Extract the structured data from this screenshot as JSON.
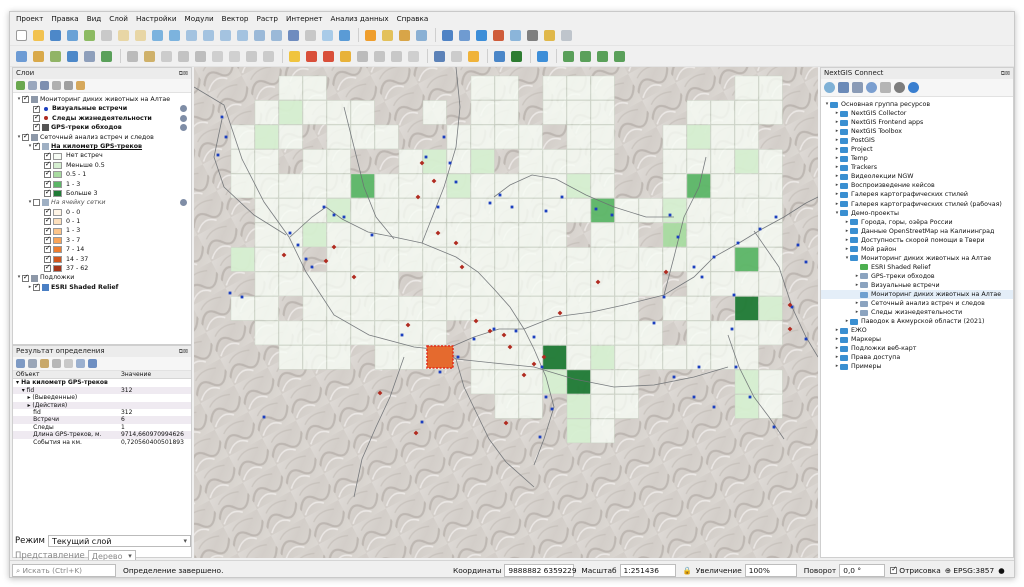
{
  "menu": [
    "Проект",
    "Правка",
    "Вид",
    "Слой",
    "Настройки",
    "Модули",
    "Вектор",
    "Растр",
    "Интернет",
    "Анализ данных",
    "Справка"
  ],
  "layers_panel": {
    "title": "Слои",
    "items": [
      {
        "label": "Мониторинг диких животных на Алтае",
        "level": 0,
        "twisty": "▾",
        "checked": true,
        "icon": "group",
        "style": ""
      },
      {
        "label": "Визуальные встречи",
        "level": 1,
        "twisty": "",
        "checked": true,
        "icon": "point-blue",
        "style": "bold",
        "flag": true
      },
      {
        "label": "Следы жизнедеятельности",
        "level": 1,
        "twisty": "",
        "checked": true,
        "icon": "point-red",
        "style": "bold",
        "flag": true
      },
      {
        "label": "GPS-треки обходов",
        "level": 1,
        "twisty": "",
        "checked": true,
        "icon": "line",
        "style": "bold",
        "flag": true
      },
      {
        "label": "Сеточный анализ встреч и следов",
        "level": 0,
        "twisty": "▾",
        "checked": true,
        "icon": "group",
        "style": ""
      },
      {
        "label": "На километр GPS-треков",
        "level": 1,
        "twisty": "▾",
        "checked": true,
        "icon": "poly",
        "style": "bold ul"
      },
      {
        "label": "Нет встреч",
        "level": 2,
        "twisty": "",
        "checked": true,
        "swatch": "#f6fbf4",
        "style": ""
      },
      {
        "label": "Меньше 0.5",
        "level": 2,
        "twisty": "",
        "checked": true,
        "swatch": "#d6efd1",
        "style": ""
      },
      {
        "label": "0.5 - 1",
        "level": 2,
        "twisty": "",
        "checked": true,
        "swatch": "#a8dba0",
        "style": ""
      },
      {
        "label": "1 - 3",
        "level": 2,
        "twisty": "",
        "checked": true,
        "swatch": "#5cb667",
        "style": ""
      },
      {
        "label": "Больше 3",
        "level": 2,
        "twisty": "",
        "checked": true,
        "swatch": "#1f7a35",
        "style": ""
      },
      {
        "label": "На ячейку сетки",
        "level": 1,
        "twisty": "▾",
        "checked": false,
        "icon": "poly",
        "style": "ital",
        "flag": true
      },
      {
        "label": "0 - 0",
        "level": 2,
        "twisty": "",
        "checked": true,
        "swatch": "#fff5e6",
        "style": ""
      },
      {
        "label": "0 - 1",
        "level": 2,
        "twisty": "",
        "checked": true,
        "swatch": "#fde0bd",
        "style": ""
      },
      {
        "label": "1 - 3",
        "level": 2,
        "twisty": "",
        "checked": true,
        "swatch": "#fcc58a",
        "style": ""
      },
      {
        "label": "3 - 7",
        "level": 2,
        "twisty": "",
        "checked": true,
        "swatch": "#f9a458",
        "style": ""
      },
      {
        "label": "7 - 14",
        "level": 2,
        "twisty": "",
        "checked": true,
        "swatch": "#ee7d2f",
        "style": ""
      },
      {
        "label": "14 - 37",
        "level": 2,
        "twisty": "",
        "checked": true,
        "swatch": "#d2561c",
        "style": ""
      },
      {
        "label": "37 - 62",
        "level": 2,
        "twisty": "",
        "checked": true,
        "swatch": "#a6361a",
        "style": ""
      },
      {
        "label": "Подложки",
        "level": 0,
        "twisty": "▾",
        "checked": true,
        "icon": "group",
        "style": ""
      },
      {
        "label": "ESRI Shaded Relief",
        "level": 1,
        "twisty": "▸",
        "checked": true,
        "icon": "raster",
        "style": "bold"
      }
    ]
  },
  "identify_panel": {
    "title": "Результат определения",
    "col_feature": "Объект",
    "col_value": "Значение",
    "rows": [
      {
        "k": "▾ На километр GPS-треков",
        "v": "",
        "bold": true
      },
      {
        "k": "   ▾ fid",
        "v": "312",
        "bold": false
      },
      {
        "k": "      ▸ (Выведенные)",
        "v": "",
        "bold": false
      },
      {
        "k": "      ▸ (Действия)",
        "v": "",
        "bold": false
      },
      {
        "k": "         fid",
        "v": "312",
        "bold": false
      },
      {
        "k": "         Встречи",
        "v": "6",
        "bold": false
      },
      {
        "k": "         Следы",
        "v": "1",
        "bold": false
      },
      {
        "k": "         Длина GPS-треков, м.",
        "v": "9714,660970994626",
        "bold": false
      },
      {
        "k": "         События на км.",
        "v": "0,720560400501893",
        "bold": false
      }
    ],
    "mode_label": "Режим",
    "mode_value": "Текущий слой",
    "view_label": "Представление",
    "view_value": "Дерево"
  },
  "connect_panel": {
    "title": "NextGIS Connect",
    "items": [
      {
        "label": "Основная группа ресурсов",
        "level": 0,
        "twisty": "▾",
        "icon": "folder"
      },
      {
        "label": "NextGIS Collector",
        "level": 1,
        "twisty": "▸",
        "icon": "folder"
      },
      {
        "label": "NextGIS Frontend apps",
        "level": 1,
        "twisty": "▸",
        "icon": "folder"
      },
      {
        "label": "NextGIS Toolbox",
        "level": 1,
        "twisty": "▸",
        "icon": "folder"
      },
      {
        "label": "PostGIS",
        "level": 1,
        "twisty": "▸",
        "icon": "folder"
      },
      {
        "label": "Project",
        "level": 1,
        "twisty": "▸",
        "icon": "folder"
      },
      {
        "label": "Temp",
        "level": 1,
        "twisty": "▸",
        "icon": "folder"
      },
      {
        "label": "Trackers",
        "level": 1,
        "twisty": "▸",
        "icon": "folder"
      },
      {
        "label": "Видеолекции NGW",
        "level": 1,
        "twisty": "▸",
        "icon": "folder"
      },
      {
        "label": "Воспроизведение кейсов",
        "level": 1,
        "twisty": "▸",
        "icon": "folder"
      },
      {
        "label": "Галерея картографических стилей",
        "level": 1,
        "twisty": "▸",
        "icon": "folder"
      },
      {
        "label": "Галерея картографических стилей (рабочая)",
        "level": 1,
        "twisty": "▸",
        "icon": "folder"
      },
      {
        "label": "Демо-проекты",
        "level": 1,
        "twisty": "▾",
        "icon": "folder"
      },
      {
        "label": "Города, горы, озёра России",
        "level": 2,
        "twisty": "▸",
        "icon": "folder"
      },
      {
        "label": "Данные OpenStreetMap на Калининград",
        "level": 2,
        "twisty": "▸",
        "icon": "folder"
      },
      {
        "label": "Доступность скорой помощи в Твери",
        "level": 2,
        "twisty": "▸",
        "icon": "folder"
      },
      {
        "label": "Мой район",
        "level": 2,
        "twisty": "▸",
        "icon": "folder"
      },
      {
        "label": "Мониторинг диких животных на Алтае",
        "level": 2,
        "twisty": "▾",
        "icon": "folder"
      },
      {
        "label": "ESRI Shaded Relief",
        "level": 3,
        "twisty": "",
        "icon": "raster"
      },
      {
        "label": "GPS-треки обходов",
        "level": 3,
        "twisty": "▸",
        "icon": "vector"
      },
      {
        "label": "Визуальные встречи",
        "level": 3,
        "twisty": "▸",
        "icon": "vector"
      },
      {
        "label": "Мониторинг диких животных на Алтае",
        "level": 3,
        "twisty": "",
        "icon": "webmap",
        "selected": true
      },
      {
        "label": "Сеточный анализ встреч и следов",
        "level": 3,
        "twisty": "▸",
        "icon": "vector"
      },
      {
        "label": "Следы жизнедеятельности",
        "level": 3,
        "twisty": "▸",
        "icon": "vector"
      },
      {
        "label": "Паводок в Акмурской области (2021)",
        "level": 2,
        "twisty": "▸",
        "icon": "folder"
      },
      {
        "label": "ЕЖО",
        "level": 1,
        "twisty": "▸",
        "icon": "folder"
      },
      {
        "label": "Маркеры",
        "level": 1,
        "twisty": "▸",
        "icon": "folder"
      },
      {
        "label": "Подложки веб-карт",
        "level": 1,
        "twisty": "▸",
        "icon": "folder"
      },
      {
        "label": "Права доступа",
        "level": 1,
        "twisty": "▸",
        "icon": "folder"
      },
      {
        "label": "Примеры",
        "level": 1,
        "twisty": "▸",
        "icon": "folder"
      }
    ]
  },
  "statusbar": {
    "search_placeholder": "Искать (Ctrl+K)",
    "message": "Определение завершено.",
    "coord_label": "Координаты",
    "coord_value": "9888882  6359229",
    "scale_label": "Масштаб",
    "scale_value": "1:251436",
    "magnifier_label": "Увеличение",
    "magnifier_value": "100%",
    "rotation_label": "Поворот",
    "rotation_value": "0,0 °",
    "render_label": "Отрисовка",
    "crs_label": "EPSG:3857"
  },
  "colors": {
    "accent": "#3a8fd1",
    "no_meet": "#f6fbf4",
    "lt05": "#d6efd1",
    "c05_1": "#a8dba0",
    "c1_3": "#5cb667",
    "gt3": "#1f7a35",
    "sighting": "#1b3fbf",
    "trace": "#b02b20",
    "selection": "#e22a1c"
  }
}
